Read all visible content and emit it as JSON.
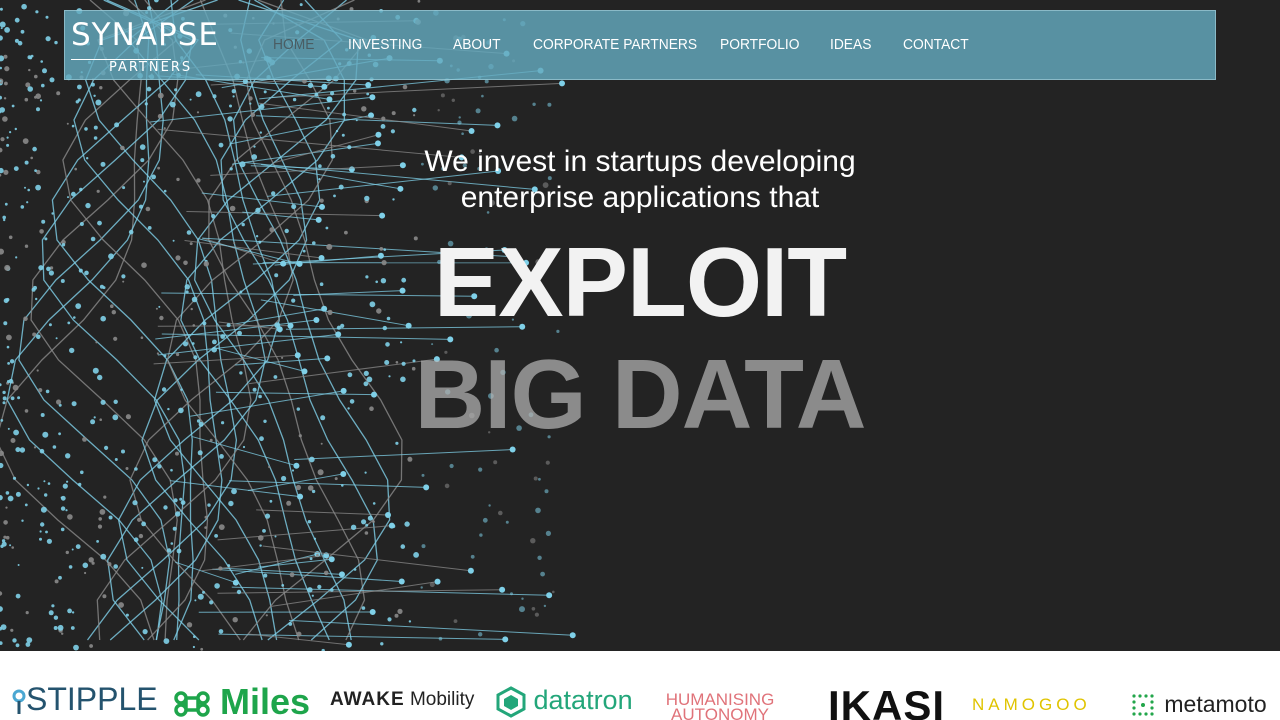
{
  "brand": {
    "name": "SYNAPSE",
    "sub": "PARTNERS"
  },
  "nav": {
    "items": [
      {
        "label": "HOME",
        "active": true
      },
      {
        "label": "INVESTING",
        "active": false
      },
      {
        "label": "ABOUT",
        "active": false
      },
      {
        "label": "CORPORATE PARTNERS",
        "active": false
      },
      {
        "label": "PORTFOLIO",
        "active": false
      },
      {
        "label": "IDEAS",
        "active": false
      },
      {
        "label": "CONTACT",
        "active": false
      }
    ]
  },
  "hero": {
    "lead_line1": "We invest in startups developing",
    "lead_line2": "enterprise applications that",
    "headline1": "EXPLOIT",
    "headline2": "BIG DATA"
  },
  "partners": {
    "stipple": "STIPPLE",
    "miles": "Miles",
    "awake_a": "AWAKE",
    "awake_b": "Mobility",
    "datatron": "datatron",
    "humanising_1": "HUMANISING",
    "humanising_2": "AUTONOMY",
    "ikasi": "IKASI",
    "namogoo": "NAMOGOO",
    "metamoto": "metamoto"
  },
  "colors": {
    "background": "#232323",
    "nav_bar": "#64aabe",
    "particle_blue": "#7fd0e8",
    "particle_grey": "#8a8a8a",
    "headline": "#f2f2f2",
    "headline_faded": "#b4b4b4"
  }
}
